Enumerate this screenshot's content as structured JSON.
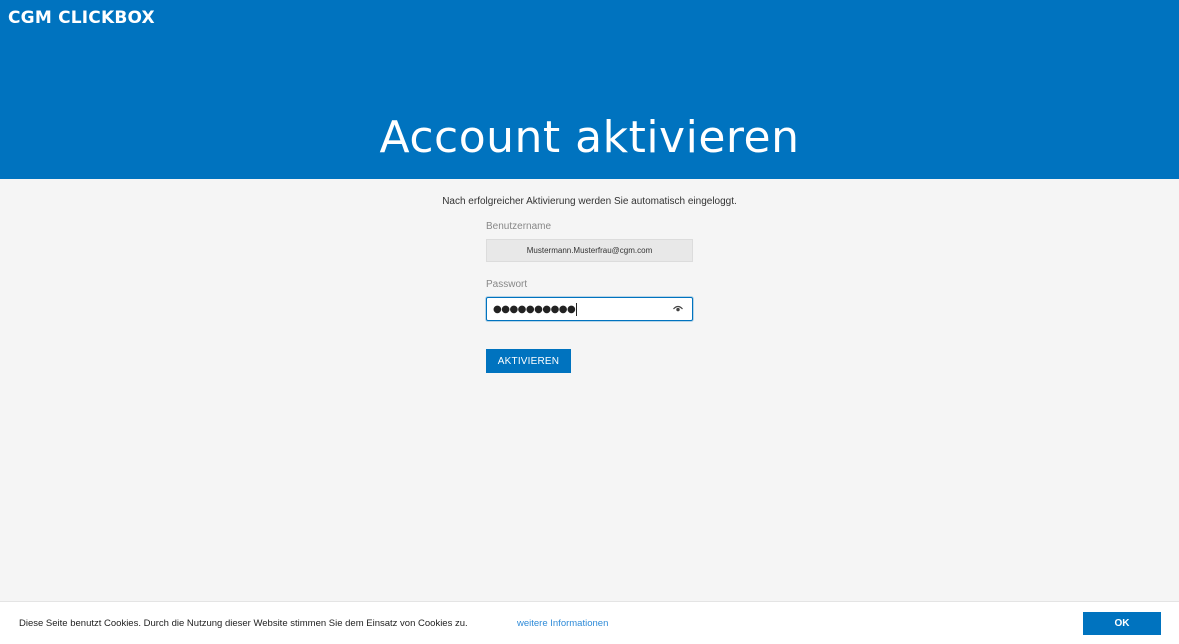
{
  "header": {
    "logo": "CGM CLICKBOX",
    "title": "Account aktivieren"
  },
  "main": {
    "intro": "Nach erfolgreicher Aktivierung werden Sie automatisch eingeloggt.",
    "username": {
      "label": "Benutzername",
      "value": "Mustermann.Musterfrau@cgm.com"
    },
    "password": {
      "label": "Passwort",
      "masked_value": "●●●●●●●●●●",
      "icon": "eye-icon"
    },
    "activate_label": "AKTIVIEREN"
  },
  "cookie_bar": {
    "text": "Diese Seite benutzt Cookies. Durch die Nutzung dieser Website stimmen Sie dem Einsatz von Cookies zu.",
    "link": "weitere Informationen",
    "ok_label": "OK"
  },
  "colors": {
    "brand": "#0073bf",
    "background": "#f5f5f5",
    "link": "#2f8bd8"
  }
}
